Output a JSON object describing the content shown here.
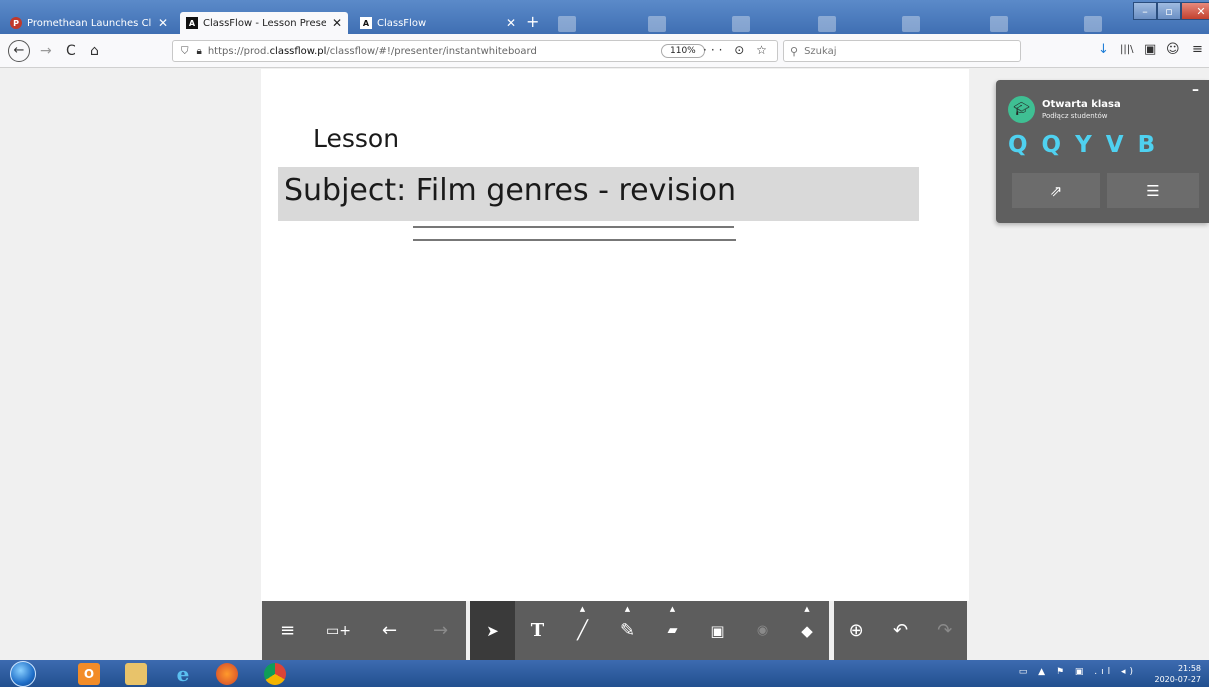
{
  "browser": {
    "tabs": [
      {
        "title": "Promethean Launches ClassFlo",
        "favicon_letter": "P",
        "favicon_color": "#c0392b",
        "active": false
      },
      {
        "title": "ClassFlow - Lesson Presenter",
        "favicon_letter": "A",
        "favicon_color": "#111111",
        "active": true
      },
      {
        "title": "ClassFlow",
        "favicon_letter": "A",
        "favicon_color": "#111111",
        "active": false
      }
    ],
    "tab_close_glyph": "✕",
    "new_tab_glyph": "+",
    "window_controls": {
      "minimize": "–",
      "maximize": "▫",
      "close": "✕"
    },
    "nav": {
      "back": "←",
      "forward": "→",
      "reload": "C",
      "home": "⌂"
    },
    "url": {
      "prefix": "https://prod.",
      "domain": "classflow.pl",
      "path": "/classflow/#!/presenter/instantwhiteboard"
    },
    "zoom": "110%",
    "url_icons": "··· ⊙ ☆",
    "search_placeholder": "Szukaj",
    "toolbar_icons": {
      "download": "↓",
      "library": "|||\\",
      "reader": "▣",
      "account": "☺",
      "menu": "≡"
    }
  },
  "whiteboard": {
    "lesson_text": "Lesson",
    "subject_text": "Subject: Film genres - revision"
  },
  "class_panel": {
    "minimize": "–",
    "title": "Otwarta klasa",
    "subtitle": "Podłącz studentów",
    "code": "Q Q Y V B",
    "share_icon": "⇗",
    "list_icon": "☰"
  },
  "toolbar": {
    "left": [
      {
        "name": "menu-button",
        "glyph": "≡"
      },
      {
        "name": "add-page-button",
        "glyph": "▭+"
      },
      {
        "name": "previous-page-button",
        "glyph": "←"
      },
      {
        "name": "next-page-button",
        "glyph": "→"
      }
    ],
    "middle": [
      {
        "name": "select-tool-button",
        "glyph": "➤"
      },
      {
        "name": "text-tool-button",
        "glyph": "T"
      },
      {
        "name": "line-tool-button",
        "glyph": "╱"
      },
      {
        "name": "pen-tool-button",
        "glyph": "✎"
      },
      {
        "name": "eraser-tool-button",
        "glyph": "▰"
      },
      {
        "name": "toolbox-button",
        "glyph": "▣"
      },
      {
        "name": "color-palette-button",
        "glyph": "◉"
      },
      {
        "name": "fill-tool-button",
        "glyph": "◆"
      }
    ],
    "right": [
      {
        "name": "zoom-button",
        "glyph": "⊕"
      },
      {
        "name": "undo-button",
        "glyph": "↶"
      },
      {
        "name": "redo-button",
        "glyph": "↷"
      }
    ]
  },
  "taskbar": {
    "clock_time": "21:58",
    "clock_date": "2020-07-27",
    "tray": "▭ ▲ ⚑ ▣ .ıl ◂)"
  }
}
